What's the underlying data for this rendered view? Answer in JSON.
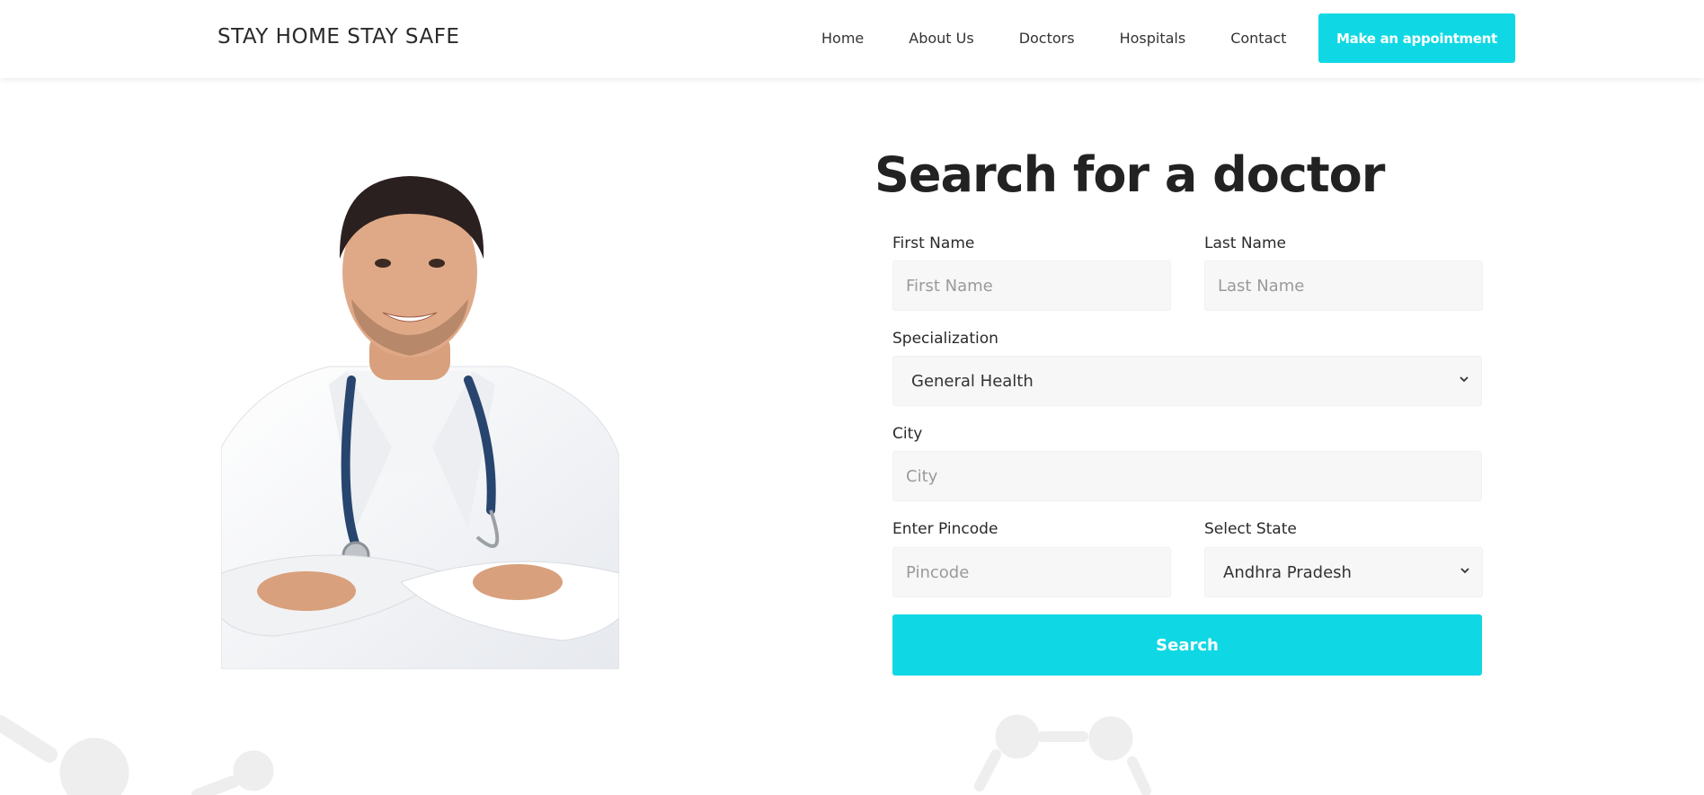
{
  "header": {
    "brand": "STAY HOME STAY SAFE",
    "nav": [
      "Home",
      "About Us",
      "Doctors",
      "Hospitals",
      "Contact"
    ],
    "cta_label": "Make an appointment"
  },
  "form": {
    "title": "Search for a doctor",
    "first_name": {
      "label": "First Name",
      "placeholder": "First Name"
    },
    "last_name": {
      "label": "Last Name",
      "placeholder": "Last Name"
    },
    "specialization": {
      "label": "Specialization",
      "value": "General Health"
    },
    "city": {
      "label": "City",
      "placeholder": "City"
    },
    "pincode": {
      "label": "Enter Pincode",
      "placeholder": "Pincode"
    },
    "state": {
      "label": "Select State",
      "value": "Andhra Pradesh"
    },
    "search_label": "Search"
  },
  "colors": {
    "accent": "#0fd8e4",
    "field_bg": "#f7f7f7"
  },
  "icons": {
    "select_chevron": "chevron-down-icon"
  }
}
